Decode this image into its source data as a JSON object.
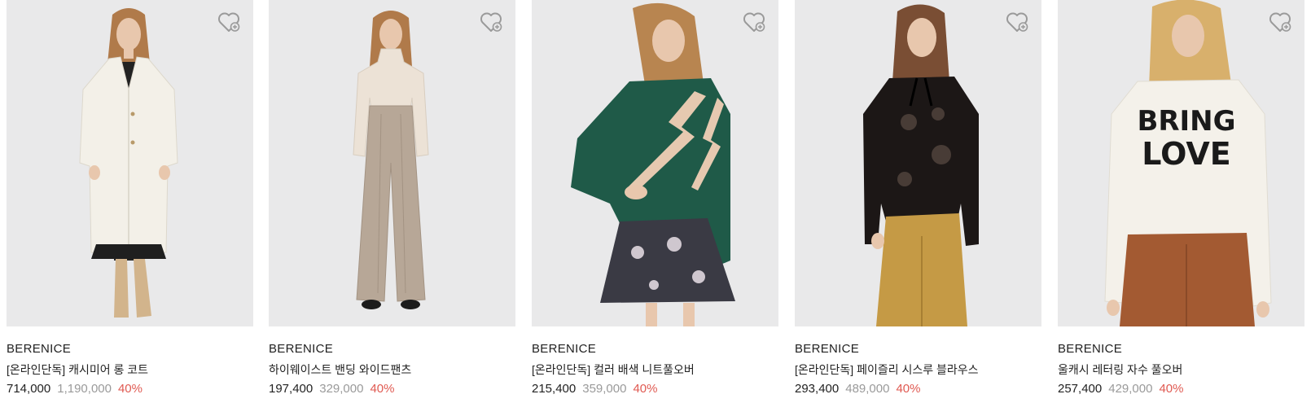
{
  "products": [
    {
      "brand": "BERENICE",
      "name": "[온라인단독] 캐시미어 롱 코트",
      "price": "714,000",
      "original_price": "1,190,000",
      "discount": "40%",
      "wishlist_icon": "heart-outline-icon"
    },
    {
      "brand": "BERENICE",
      "name": "하이웨이스트 밴딩 와이드팬츠",
      "price": "197,400",
      "original_price": "329,000",
      "discount": "40%",
      "wishlist_icon": "heart-outline-icon"
    },
    {
      "brand": "BERENICE",
      "name": "[온라인단독] 컬러 배색 니트풀오버",
      "price": "215,400",
      "original_price": "359,000",
      "discount": "40%",
      "wishlist_icon": "heart-outline-icon"
    },
    {
      "brand": "BERENICE",
      "name": "[온라인단독] 페이즐리 시스루 블라우스",
      "price": "293,400",
      "original_price": "489,000",
      "discount": "40%",
      "wishlist_icon": "heart-outline-icon"
    },
    {
      "brand": "BERENICE",
      "name": "울캐시 레터링 자수 풀오버",
      "price": "257,400",
      "original_price": "429,000",
      "discount": "40%",
      "wishlist_icon": "heart-outline-icon",
      "garment_print": [
        "BRING",
        "LOVE"
      ]
    }
  ],
  "colors": {
    "image_background": "#e9e9ea",
    "discount": "#e05a52",
    "original_price": "#9a9a9a",
    "text": "#222222"
  }
}
